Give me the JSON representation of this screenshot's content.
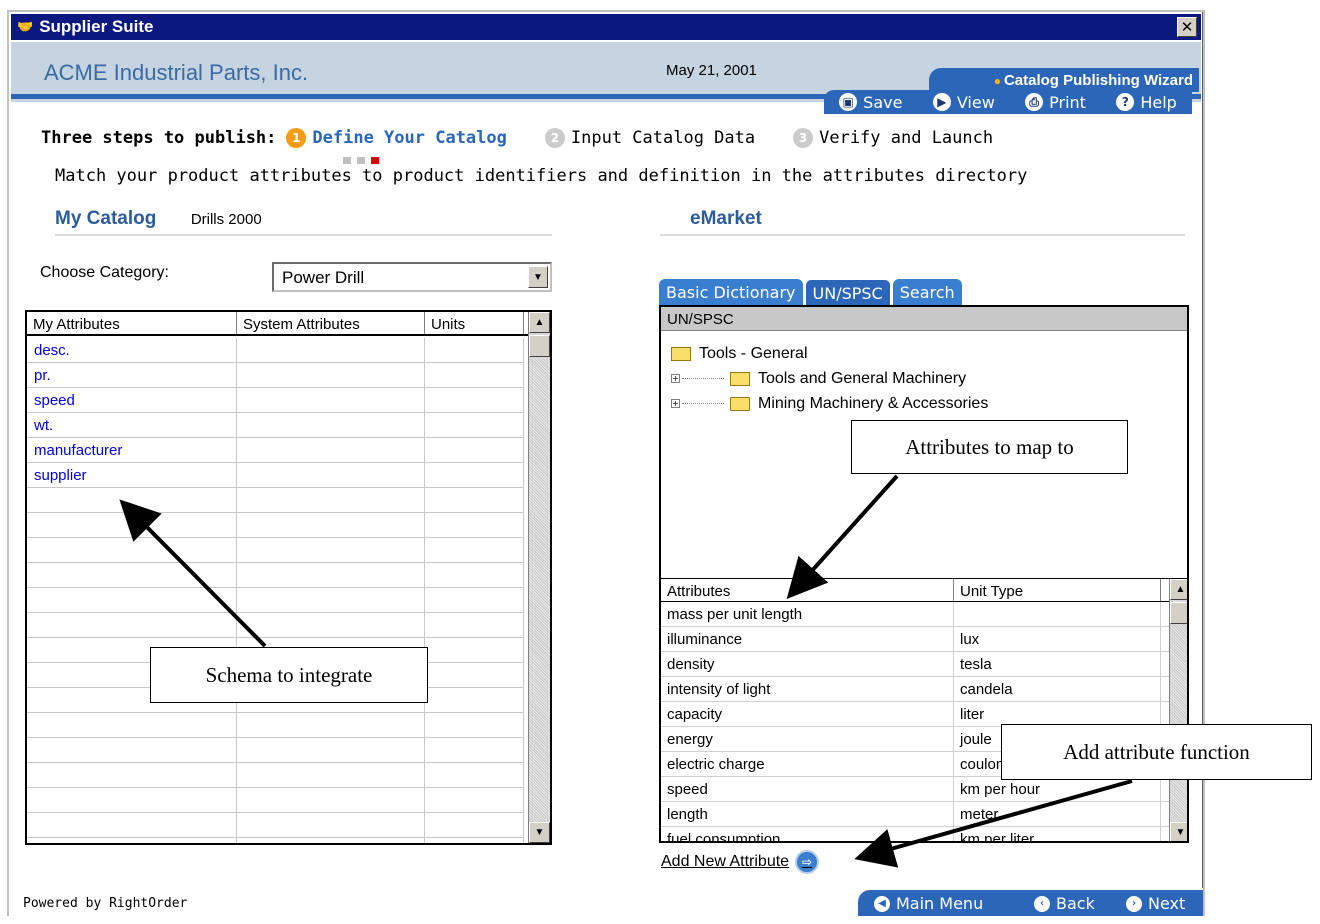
{
  "window": {
    "title": "Supplier Suite",
    "close_glyph": "✕"
  },
  "header": {
    "company": "ACME Industrial Parts, Inc.",
    "date": "May 21, 2001",
    "wizard": "Catalog Publishing Wizard"
  },
  "toolbar": {
    "save": "Save",
    "view": "View",
    "print": "Print",
    "help": "Help"
  },
  "steps": {
    "lead": "Three steps to publish:",
    "items": [
      {
        "num": "1",
        "label": "Define Your Catalog"
      },
      {
        "num": "2",
        "label": "Input Catalog Data"
      },
      {
        "num": "3",
        "label": "Verify and Launch"
      }
    ]
  },
  "instruction": "Match your product attributes to product identifiers and definition in the attributes directory",
  "my_catalog": {
    "title": "My Catalog",
    "name": "Drills 2000",
    "choose_label": "Choose Category:",
    "category": "Power Drill",
    "columns": [
      "My Attributes",
      "System Attributes",
      "Units"
    ],
    "rows": [
      "desc.",
      "pr.",
      "speed",
      "wt.",
      "manufacturer",
      "supplier"
    ]
  },
  "emarket": {
    "title": "eMarket",
    "tabs": [
      "Basic Dictionary",
      "UN/SPSC",
      "Search"
    ],
    "panel_title": "UN/SPSC",
    "tree": {
      "root": "Tools - General",
      "children": [
        "Tools and General Machinery",
        "Mining Machinery & Accessories"
      ]
    },
    "attr_columns": [
      "Attributes",
      "Unit Type"
    ],
    "attributes": [
      {
        "name": "mass per unit length",
        "unit": ""
      },
      {
        "name": "illuminance",
        "unit": "lux"
      },
      {
        "name": "density",
        "unit": "tesla"
      },
      {
        "name": "intensity of light",
        "unit": "candela"
      },
      {
        "name": "capacity",
        "unit": "liter"
      },
      {
        "name": "energy",
        "unit": "joule"
      },
      {
        "name": "electric charge",
        "unit": "coulomb"
      },
      {
        "name": "speed",
        "unit": "km per hour"
      },
      {
        "name": "length",
        "unit": "meter"
      },
      {
        "name": "fuel consumption",
        "unit": "km per liter"
      }
    ],
    "add_attribute": "Add New Attribute"
  },
  "footer": {
    "powered": "Powered by RightOrder",
    "main_menu": "Main Menu",
    "back": "Back",
    "next": "Next"
  },
  "callouts": {
    "map_to": "Attributes to map to",
    "schema": "Schema to integrate",
    "add_function": "Add attribute function"
  }
}
